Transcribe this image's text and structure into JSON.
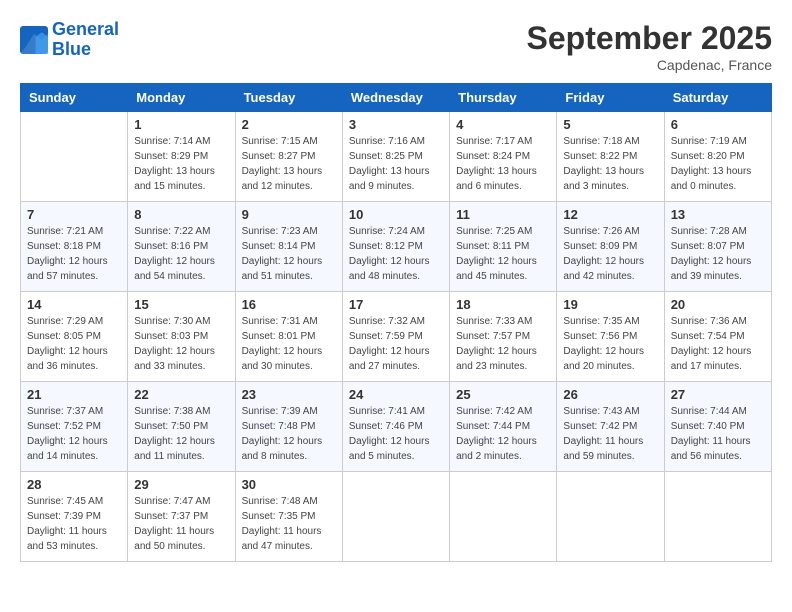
{
  "header": {
    "logo_line1": "General",
    "logo_line2": "Blue",
    "month": "September 2025",
    "location": "Capdenac, France"
  },
  "columns": [
    "Sunday",
    "Monday",
    "Tuesday",
    "Wednesday",
    "Thursday",
    "Friday",
    "Saturday"
  ],
  "weeks": [
    [
      {
        "day": "",
        "info": ""
      },
      {
        "day": "1",
        "info": "Sunrise: 7:14 AM\nSunset: 8:29 PM\nDaylight: 13 hours\nand 15 minutes."
      },
      {
        "day": "2",
        "info": "Sunrise: 7:15 AM\nSunset: 8:27 PM\nDaylight: 13 hours\nand 12 minutes."
      },
      {
        "day": "3",
        "info": "Sunrise: 7:16 AM\nSunset: 8:25 PM\nDaylight: 13 hours\nand 9 minutes."
      },
      {
        "day": "4",
        "info": "Sunrise: 7:17 AM\nSunset: 8:24 PM\nDaylight: 13 hours\nand 6 minutes."
      },
      {
        "day": "5",
        "info": "Sunrise: 7:18 AM\nSunset: 8:22 PM\nDaylight: 13 hours\nand 3 minutes."
      },
      {
        "day": "6",
        "info": "Sunrise: 7:19 AM\nSunset: 8:20 PM\nDaylight: 13 hours\nand 0 minutes."
      }
    ],
    [
      {
        "day": "7",
        "info": "Sunrise: 7:21 AM\nSunset: 8:18 PM\nDaylight: 12 hours\nand 57 minutes."
      },
      {
        "day": "8",
        "info": "Sunrise: 7:22 AM\nSunset: 8:16 PM\nDaylight: 12 hours\nand 54 minutes."
      },
      {
        "day": "9",
        "info": "Sunrise: 7:23 AM\nSunset: 8:14 PM\nDaylight: 12 hours\nand 51 minutes."
      },
      {
        "day": "10",
        "info": "Sunrise: 7:24 AM\nSunset: 8:12 PM\nDaylight: 12 hours\nand 48 minutes."
      },
      {
        "day": "11",
        "info": "Sunrise: 7:25 AM\nSunset: 8:11 PM\nDaylight: 12 hours\nand 45 minutes."
      },
      {
        "day": "12",
        "info": "Sunrise: 7:26 AM\nSunset: 8:09 PM\nDaylight: 12 hours\nand 42 minutes."
      },
      {
        "day": "13",
        "info": "Sunrise: 7:28 AM\nSunset: 8:07 PM\nDaylight: 12 hours\nand 39 minutes."
      }
    ],
    [
      {
        "day": "14",
        "info": "Sunrise: 7:29 AM\nSunset: 8:05 PM\nDaylight: 12 hours\nand 36 minutes."
      },
      {
        "day": "15",
        "info": "Sunrise: 7:30 AM\nSunset: 8:03 PM\nDaylight: 12 hours\nand 33 minutes."
      },
      {
        "day": "16",
        "info": "Sunrise: 7:31 AM\nSunset: 8:01 PM\nDaylight: 12 hours\nand 30 minutes."
      },
      {
        "day": "17",
        "info": "Sunrise: 7:32 AM\nSunset: 7:59 PM\nDaylight: 12 hours\nand 27 minutes."
      },
      {
        "day": "18",
        "info": "Sunrise: 7:33 AM\nSunset: 7:57 PM\nDaylight: 12 hours\nand 23 minutes."
      },
      {
        "day": "19",
        "info": "Sunrise: 7:35 AM\nSunset: 7:56 PM\nDaylight: 12 hours\nand 20 minutes."
      },
      {
        "day": "20",
        "info": "Sunrise: 7:36 AM\nSunset: 7:54 PM\nDaylight: 12 hours\nand 17 minutes."
      }
    ],
    [
      {
        "day": "21",
        "info": "Sunrise: 7:37 AM\nSunset: 7:52 PM\nDaylight: 12 hours\nand 14 minutes."
      },
      {
        "day": "22",
        "info": "Sunrise: 7:38 AM\nSunset: 7:50 PM\nDaylight: 12 hours\nand 11 minutes."
      },
      {
        "day": "23",
        "info": "Sunrise: 7:39 AM\nSunset: 7:48 PM\nDaylight: 12 hours\nand 8 minutes."
      },
      {
        "day": "24",
        "info": "Sunrise: 7:41 AM\nSunset: 7:46 PM\nDaylight: 12 hours\nand 5 minutes."
      },
      {
        "day": "25",
        "info": "Sunrise: 7:42 AM\nSunset: 7:44 PM\nDaylight: 12 hours\nand 2 minutes."
      },
      {
        "day": "26",
        "info": "Sunrise: 7:43 AM\nSunset: 7:42 PM\nDaylight: 11 hours\nand 59 minutes."
      },
      {
        "day": "27",
        "info": "Sunrise: 7:44 AM\nSunset: 7:40 PM\nDaylight: 11 hours\nand 56 minutes."
      }
    ],
    [
      {
        "day": "28",
        "info": "Sunrise: 7:45 AM\nSunset: 7:39 PM\nDaylight: 11 hours\nand 53 minutes."
      },
      {
        "day": "29",
        "info": "Sunrise: 7:47 AM\nSunset: 7:37 PM\nDaylight: 11 hours\nand 50 minutes."
      },
      {
        "day": "30",
        "info": "Sunrise: 7:48 AM\nSunset: 7:35 PM\nDaylight: 11 hours\nand 47 minutes."
      },
      {
        "day": "",
        "info": ""
      },
      {
        "day": "",
        "info": ""
      },
      {
        "day": "",
        "info": ""
      },
      {
        "day": "",
        "info": ""
      }
    ]
  ]
}
